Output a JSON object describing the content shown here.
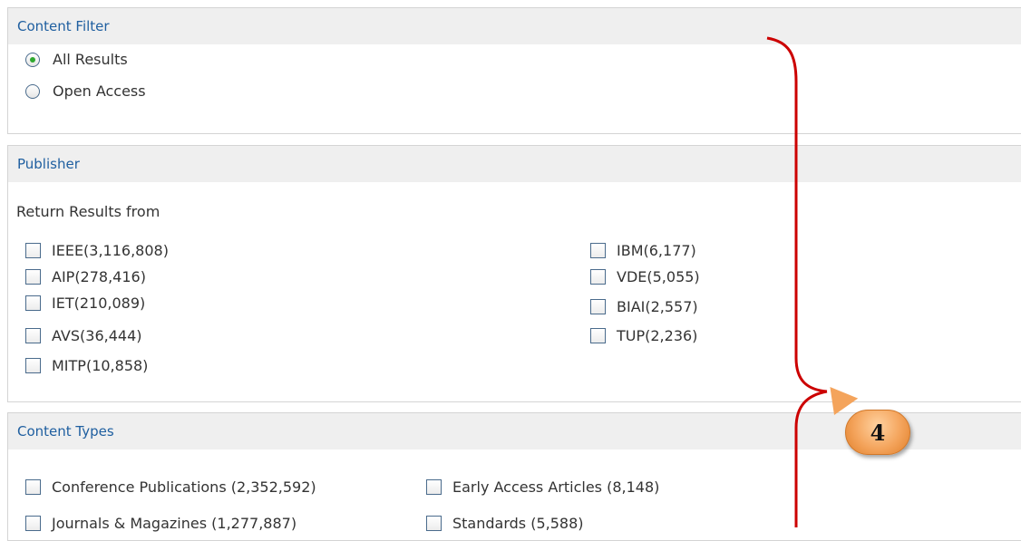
{
  "content_filter": {
    "title": "Content Filter",
    "options": [
      {
        "label": "All Results",
        "checked": true
      },
      {
        "label": "Open Access",
        "checked": false
      }
    ]
  },
  "publisher": {
    "title": "Publisher",
    "subtitle": "Return Results from",
    "col1": [
      "IEEE(3,116,808)",
      "AIP(278,416)",
      "IET(210,089)",
      "AVS(36,444)",
      "MITP(10,858)"
    ],
    "col2": [
      "IBM(6,177)",
      "VDE(5,055)",
      "BIAI(2,557)",
      "TUP(2,236)"
    ]
  },
  "content_types": {
    "title": "Content Types",
    "col1": [
      "Conference Publications (2,352,592)",
      "Journals & Magazines (1,277,887)"
    ],
    "col2": [
      "Early Access Articles (8,148)",
      "Standards (5,588)"
    ]
  },
  "annotation": {
    "badge_label": "4",
    "color": "#cc0000",
    "badge_color": "#f4a45c"
  }
}
